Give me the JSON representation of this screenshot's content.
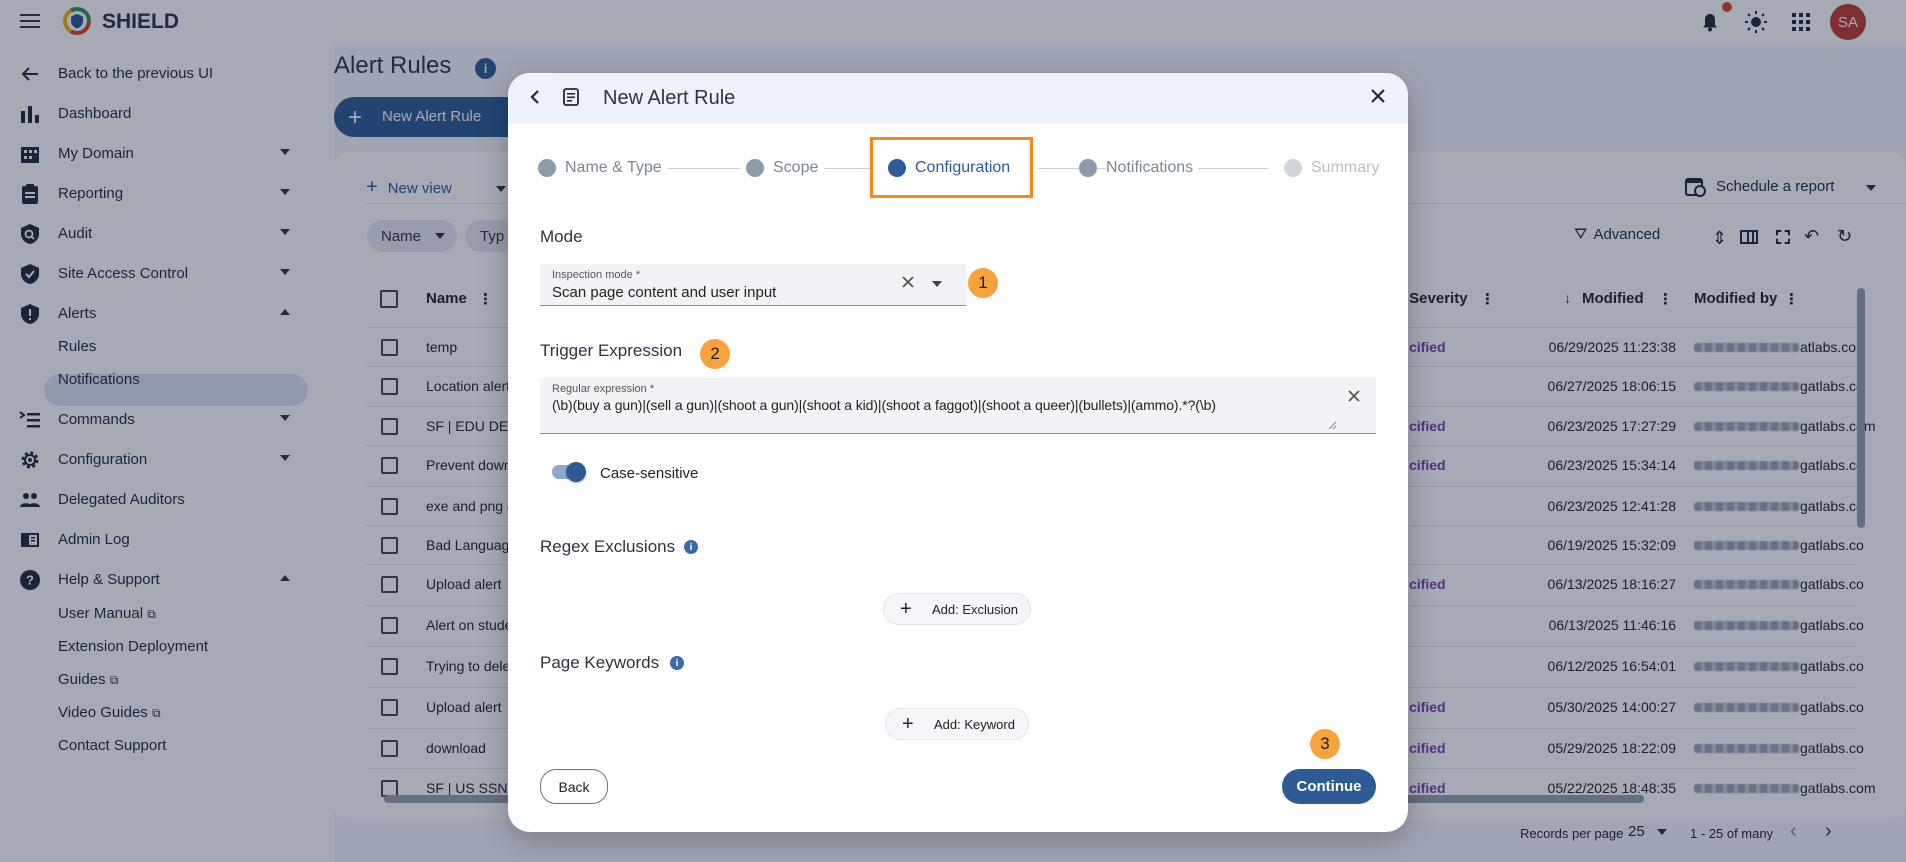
{
  "app": {
    "name": "SHIELD",
    "avatar": "SA"
  },
  "sidebar": {
    "back": "Back to the previous UI",
    "items": [
      {
        "label": "Dashboard"
      },
      {
        "label": "My Domain"
      },
      {
        "label": "Reporting"
      },
      {
        "label": "Audit"
      },
      {
        "label": "Site Access Control"
      },
      {
        "label": "Alerts"
      },
      {
        "label": "Commands"
      },
      {
        "label": "Configuration"
      },
      {
        "label": "Delegated Auditors"
      },
      {
        "label": "Admin Log"
      },
      {
        "label": "Help & Support"
      }
    ],
    "alerts_sub": [
      "Rules",
      "Notifications"
    ],
    "help_sub": [
      "User Manual",
      "Extension Deployment",
      "Guides",
      "Video Guides",
      "Contact Support"
    ]
  },
  "page": {
    "title": "Alert Rules",
    "new_button": "New Alert Rule",
    "new_view": "New view",
    "schedule": "Schedule a report",
    "advanced": "Advanced",
    "filters": [
      "Name",
      "Typ"
    ],
    "columns": {
      "name": "Name",
      "severity": "t Severity",
      "modified": "Modified",
      "modified_by": "Modified by"
    },
    "rows": [
      {
        "name": "temp",
        "sev": "cified",
        "modified": "06/29/2025 11:23:38",
        "by": "atlabs.co"
      },
      {
        "name": "Location alert",
        "sev": "",
        "modified": "06/27/2025 18:06:15",
        "by": "gatlabs.co"
      },
      {
        "name": "SF | EDU DEM",
        "sev": "cified",
        "modified": "06/23/2025 17:27:29",
        "by": "gatlabs.com"
      },
      {
        "name": "Prevent down",
        "sev": "cified",
        "modified": "06/23/2025 15:34:14",
        "by": "gatlabs.co"
      },
      {
        "name": "exe and png d",
        "sev": "",
        "modified": "06/23/2025 12:41:28",
        "by": "gatlabs.co"
      },
      {
        "name": "Bad Language",
        "sev": "",
        "modified": "06/19/2025 15:32:09",
        "by": "gatlabs.co"
      },
      {
        "name": "Upload alert",
        "sev": "cified",
        "modified": "06/13/2025 18:16:27",
        "by": "gatlabs.co"
      },
      {
        "name": "Alert on stude",
        "sev": "",
        "modified": "06/13/2025 11:46:16",
        "by": "gatlabs.co"
      },
      {
        "name": "Trying to dele",
        "sev": "",
        "modified": "06/12/2025 16:54:01",
        "by": "gatlabs.co"
      },
      {
        "name": "Upload alert",
        "sev": "cified",
        "modified": "05/30/2025 14:00:27",
        "by": "gatlabs.co"
      },
      {
        "name": "download",
        "sev": "cified",
        "modified": "05/29/2025 18:22:09",
        "by": "gatlabs.co"
      },
      {
        "name": "SF | US SSN",
        "sev": "cified",
        "modified": "05/22/2025 18:48:35",
        "by": "gatlabs.com"
      }
    ],
    "records_per_page_label": "Records per page",
    "records_per_page": "25",
    "range": "1 - 25 of many"
  },
  "dialog": {
    "title": "New Alert Rule",
    "steps": [
      "Name & Type",
      "Scope",
      "Configuration",
      "Notifications",
      "Summary"
    ],
    "mode_title": "Mode",
    "inspection_label": "Inspection mode *",
    "inspection_value": "Scan page content and user input",
    "trigger_title": "Trigger Expression",
    "regex_label": "Regular expression *",
    "regex_value": "(\\b)(buy a gun)|(sell a gun)|(shoot a gun)|(shoot a kid)|(shoot a faggot)|(shoot a queer)|(bullets)|(ammo).*?(\\b)",
    "case_label": "Case-sensitive",
    "case_on": true,
    "exclusions_title": "Regex Exclusions",
    "add_exclusion": "Add: Exclusion",
    "keywords_title": "Page Keywords",
    "add_keyword": "Add: Keyword",
    "back": "Back",
    "continue": "Continue",
    "badges": [
      "1",
      "2",
      "3"
    ]
  },
  "colors": {
    "primary": "#2e5b95",
    "accent": "#f7a23b",
    "highlight": "#f08a1a"
  }
}
